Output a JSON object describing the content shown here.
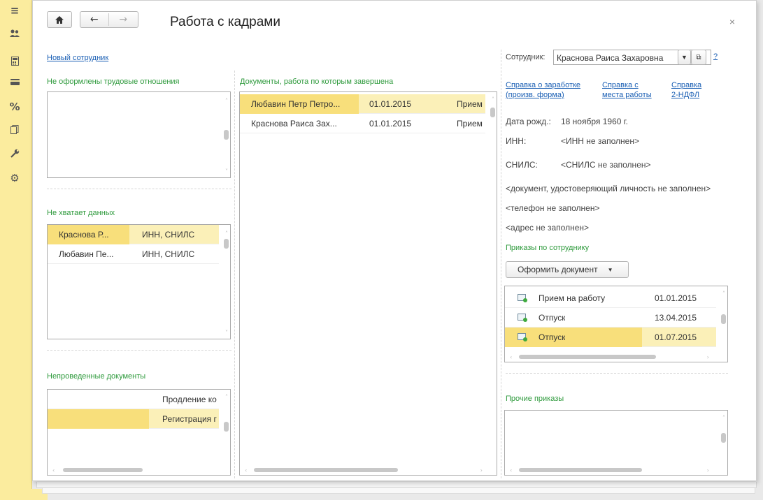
{
  "window": {
    "title": "Работа с кадрами",
    "close_label": "×"
  },
  "nav": {
    "home_icon": "home-icon",
    "back_icon": "back-arrow-icon",
    "forward_icon": "forward-arrow-icon"
  },
  "sidebar": {
    "icons": [
      "menu-icon",
      "users-icon",
      "calculator-icon",
      "card-icon",
      "percent-icon",
      "documents-icon",
      "wrench-icon",
      "gear-icon"
    ]
  },
  "left": {
    "new_employee_link": "Новый сотрудник",
    "no_contract": {
      "title": "Не оформлены трудовые отношения"
    },
    "missing_data": {
      "title": "Не хватает данных",
      "rows": [
        {
          "name": "Краснова Р...",
          "missing": "ИНН, СНИЛС"
        },
        {
          "name": "Любавин Пе...",
          "missing": "ИНН, СНИЛС"
        }
      ]
    },
    "unposted": {
      "title": "Непроведенные документы",
      "rows": [
        {
          "doc": "Продление ко"
        },
        {
          "doc": "Регистрация г"
        }
      ]
    }
  },
  "middle": {
    "title": "Документы, работа по которым завершена",
    "rows": [
      {
        "name": "Любавин Петр Петро...",
        "date": "01.01.2015",
        "type": "Прием"
      },
      {
        "name": "Краснова Раиса Зах...",
        "date": "01.01.2015",
        "type": "Прием"
      }
    ]
  },
  "right": {
    "employee_label": "Сотрудник:",
    "employee_value": "Краснова Раиса Захаровна",
    "help_label": "?",
    "links": [
      {
        "line1": "Справка о заработке",
        "line2": "(произв. форма)"
      },
      {
        "line1": "Справка с",
        "line2": "места работы"
      },
      {
        "line1": "Справка",
        "line2": "2-НДФЛ"
      }
    ],
    "birth_label": "Дата рожд.:",
    "birth_value": "18 ноября 1960 г.",
    "inn_label": "ИНН:",
    "inn_value": "<ИНН не заполнен>",
    "snils_label": "СНИЛС:",
    "snils_value": "<СНИЛС не заполнен>",
    "id_doc": "<документ, удостоверяющий личность не заполнен>",
    "phone": "<телефон не заполнен>",
    "address": "<адрес не заполнен>",
    "orders_title": "Приказы по сотруднику",
    "create_doc_button": "Оформить документ",
    "orders": [
      {
        "name": "Прием на работу",
        "date": "01.01.2015"
      },
      {
        "name": "Отпуск",
        "date": "13.04.2015"
      },
      {
        "name": "Отпуск",
        "date": "01.07.2015"
      }
    ],
    "other_orders_title": "Прочие приказы"
  }
}
